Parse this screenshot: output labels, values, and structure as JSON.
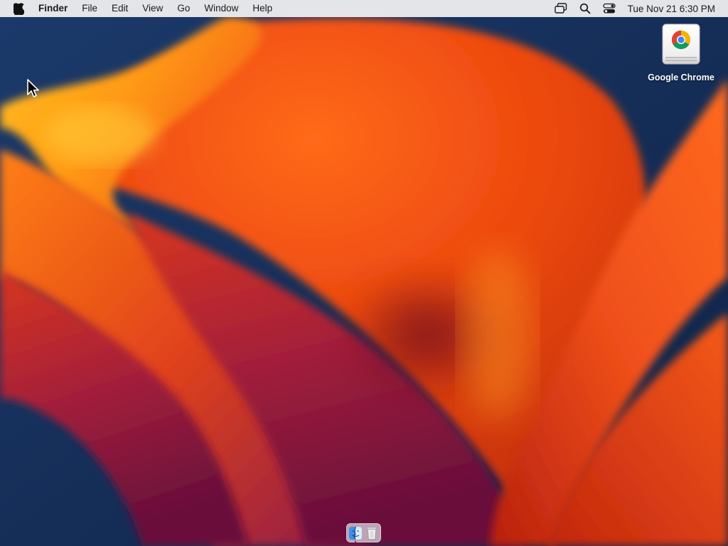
{
  "menubar": {
    "apple_icon": "apple-logo-icon",
    "app_name": "Finder",
    "items": [
      "File",
      "Edit",
      "View",
      "Go",
      "Window",
      "Help"
    ],
    "status_icons": [
      "screen-mirroring-icon",
      "spotlight-search-icon",
      "control-center-icon"
    ],
    "clock": "Tue Nov 21  6:30 PM"
  },
  "desktop": {
    "icons": [
      {
        "label": "Google Chrome",
        "icon": "chrome-drive-icon"
      }
    ]
  },
  "dock": {
    "apps": [
      {
        "icon": "finder-icon",
        "running": true
      },
      {
        "icon": "trash-icon",
        "running": false
      }
    ]
  },
  "colors": {
    "menubar_bg": "#ececee",
    "wallpaper_deep": "#17305a",
    "wallpaper_orange": "#f0561a",
    "wallpaper_yellow": "#ffb21a",
    "wallpaper_magenta": "#8a1a45"
  }
}
